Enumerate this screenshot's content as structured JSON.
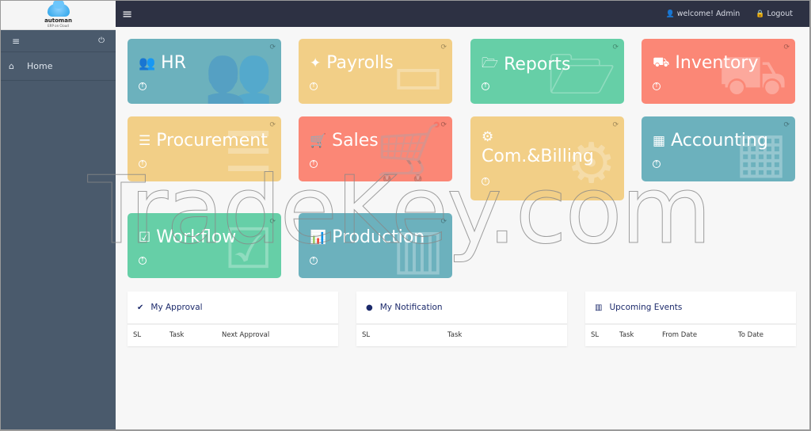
{
  "logo": {
    "name": "automan",
    "tagline": "ERP on Cloud"
  },
  "sidebar": {
    "menu_icon": "≡",
    "power_icon": "⏻",
    "items": [
      {
        "label": "Home",
        "icon": "home-icon"
      }
    ]
  },
  "topbar": {
    "menu_icon": "≡",
    "welcome": "welcome! Admin",
    "logout": "Logout"
  },
  "tiles": [
    {
      "label": "HR",
      "icon": "users-icon",
      "color": "#6cb1bd"
    },
    {
      "label": "Payrolls",
      "icon": "magic-wand-icon",
      "color": "#f2cf87"
    },
    {
      "label": "Reports",
      "icon": "folder-open-icon",
      "color": "#66cfa7"
    },
    {
      "label": "Inventory",
      "icon": "truck-icon",
      "color": "#fb8776"
    },
    {
      "label": "Procurement",
      "icon": "stack-icon",
      "color": "#f2cf87"
    },
    {
      "label": "Sales",
      "icon": "cart-icon",
      "color": "#fb8776"
    },
    {
      "label": "Com.&Billing",
      "icon": "gears-icon",
      "color": "#f2cf87"
    },
    {
      "label": "Accounting",
      "icon": "building-icon",
      "color": "#6cb1bd"
    },
    {
      "label": "Workflow",
      "icon": "check-square-icon",
      "color": "#66cfa7"
    },
    {
      "label": "Production",
      "icon": "bar-chart-icon",
      "color": "#6cb1bd"
    }
  ],
  "panels": [
    {
      "title": "My Approval",
      "icon": "check-icon",
      "columns": [
        "SL",
        "Task",
        "Next Approval"
      ]
    },
    {
      "title": "My Notification",
      "icon": "globe-icon",
      "columns": [
        "SL",
        "Task"
      ]
    },
    {
      "title": "Upcoming Events",
      "icon": "bar-chart-icon",
      "columns": [
        "SL",
        "Task",
        "From Date",
        "To Date"
      ]
    }
  ],
  "watermark": "TradeKey.com"
}
